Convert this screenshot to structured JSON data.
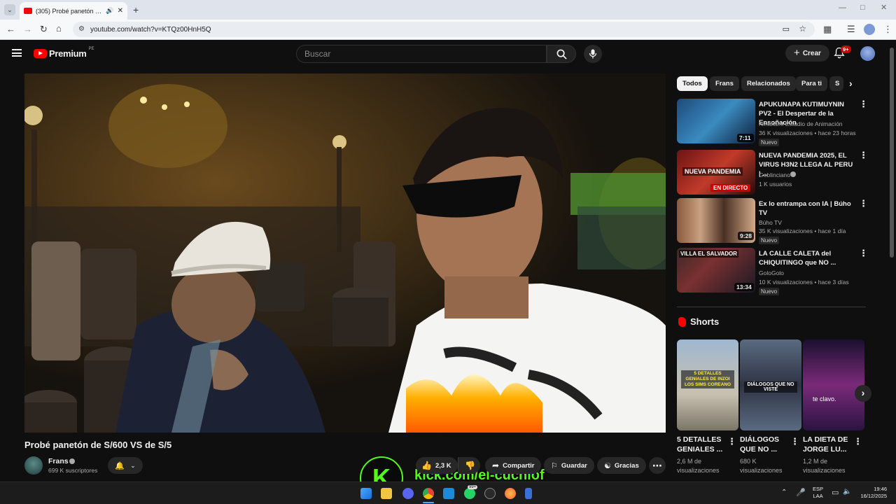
{
  "browser": {
    "tab_title": "(305) Probé panetón de S/600 VS de S/5",
    "url": "youtube.com/watch?v=KTQz00HnH5Q"
  },
  "header": {
    "logo_text": "Premium",
    "region": "PE",
    "search_placeholder": "Buscar",
    "create_label": "Crear",
    "notif_count": "9+"
  },
  "video": {
    "title": "Probé panetón de S/600 VS de S/5",
    "channel": "Frans",
    "subscribers": "699 K suscriptores",
    "likes": "2,3 K",
    "share_label": "Compartir",
    "save_label": "Guardar",
    "thanks_label": "Gracias",
    "overlay_text": "kick.com/el-cuchiof",
    "overlay_logo": "K"
  },
  "chips": [
    "Todos",
    "Frans",
    "Relacionados",
    "Para ti",
    "S"
  ],
  "recommendations": [
    {
      "title": "APUKUNAPA KUTIMUYNIN PV2 - El Despertar de la Ensoñación",
      "channel": "Ninakami Estudio de Animación",
      "meta": "36 K visualizaciones • hace 23 horas",
      "badge": "Nuevo",
      "duration": "7:11",
      "thumb_text": ""
    },
    {
      "title": "NUEVA PANDEMIA 2025, EL VIRUS H3N2 LLEGA AL PERU | ...",
      "channel": "Goblinciano",
      "meta": "1 K usuarios",
      "badge": "",
      "duration": "EN DIRECTO",
      "thumb_text": "NUEVA PANDEMIA"
    },
    {
      "title": "Ex lo entrampa con IA | Búho TV",
      "channel": "Búho TV",
      "meta": "35 K visualizaciones • hace 1 día",
      "badge": "Nuevo",
      "duration": "9:28",
      "thumb_text": ""
    },
    {
      "title": "LA CALLE CALETA del CHIQUITINGO que NO ...",
      "channel": "GoloGolo",
      "meta": "10 K visualizaciones • hace 3 días",
      "badge": "Nuevo",
      "duration": "13:34",
      "thumb_text": "VILLA EL SALVADOR"
    }
  ],
  "shorts": {
    "heading": "Shorts",
    "items": [
      {
        "title": "5 DETALLES GENIALES ...",
        "meta": "2,6 M de visualizaciones",
        "thumb_text": "5 DETALLES GENIALES DE INZOI LOS SIMS COREANO"
      },
      {
        "title": "DIÁLOGOS QUE NO ...",
        "meta": "680 K visualizaciones",
        "thumb_text": "DIÁLOGOS QUE NO VISTE"
      },
      {
        "title": "LA DIETA DE JORGE LU...",
        "meta": "1,2 M de visualizaciones",
        "thumb_text": "te clavo."
      }
    ]
  },
  "taskbar": {
    "lang1": "ESP",
    "lang2": "LAA",
    "time": "19:46",
    "date": "16/12/2025",
    "whatsapp_badge": "99+"
  },
  "colors": {
    "yt_red": "#ff0000",
    "bg": "#0f0f0f",
    "chrome_bg": "#dfe3eb",
    "kick_green": "#53fc18"
  }
}
